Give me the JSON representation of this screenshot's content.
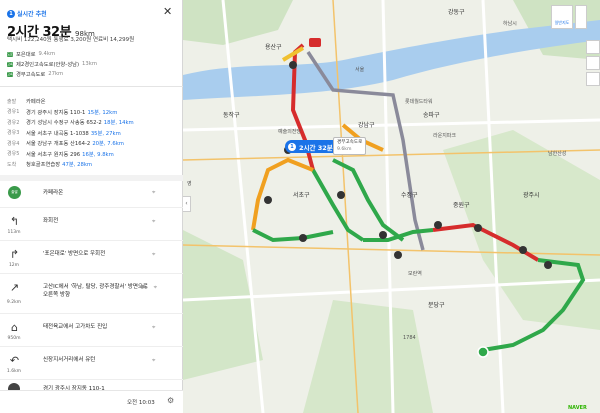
{
  "header": {
    "badge_num": "1",
    "badge_label": "실시간 추천",
    "time": "2시간 32분",
    "distance": "98km",
    "fee": "택시비 122,240원  통행료 3,200원  연료비 14,299원",
    "close": "✕"
  },
  "roads": [
    {
      "tag": "도로",
      "name": "포은대로",
      "dist": "9.4km"
    },
    {
      "tag": "고속",
      "name": "제2경인고속도로(안양-성남)",
      "dist": "13km"
    },
    {
      "tag": "고속",
      "name": "경부고속도로",
      "dist": "27km"
    }
  ],
  "summary": [
    {
      "k": "출발",
      "v": "카페라온",
      "b": ""
    },
    {
      "k": "경유1",
      "v": "경기 광주시 장지동 110-1",
      "b": "15분, 12km"
    },
    {
      "k": "경유2",
      "v": "경기 성남시 수정구 사송동 652-2",
      "b": "18분, 14km"
    },
    {
      "k": "경유3",
      "v": "서울 서초구 내곡동 1-1038",
      "b": "35분, 27km"
    },
    {
      "k": "경유4",
      "v": "서울 강남구 개포동 산164-2",
      "b": "20분, 7.6km"
    },
    {
      "k": "경유5",
      "v": "서울 서초구 원지동 296",
      "b": "16분, 9.8km"
    },
    {
      "k": "도착",
      "v": "청호골프연습장",
      "b": "47분, 28km"
    }
  ],
  "steps": [
    {
      "dist": "",
      "text": "카페라온",
      "kind": "start",
      "start_tag": "출발"
    },
    {
      "dist": "113m",
      "text": "좌회전",
      "icon": "↰"
    },
    {
      "dist": "12m",
      "text": "'포은대로' 방면으로 우회전",
      "icon": "↱"
    },
    {
      "dist": "9.2km",
      "text": "고산IC에서 '하남, 탈당, 광주경찰서' 방면으로 오른쪽 방향",
      "icon": "↗"
    },
    {
      "dist": "950m",
      "text": "태전육교에서 고가차도 진입",
      "icon": "⌂"
    },
    {
      "dist": "1.6km",
      "text": "신장지서거리에서 유턴",
      "icon": "↶"
    },
    {
      "dist": "112m",
      "text": "경기 광주시 장지동 110-1",
      "kind": "end"
    }
  ],
  "footer": {
    "clock": "오전 10:03"
  },
  "map": {
    "badge_num": "1",
    "badge_text": "2시간 32분",
    "box_line1": "경부고속도로",
    "box_line2": "9.6km",
    "top_btn": "일반지도",
    "logo": "NAVER",
    "labels": [
      {
        "t": "용산구"
      },
      {
        "t": "동작구"
      },
      {
        "t": "서초구"
      },
      {
        "t": "강남구"
      },
      {
        "t": "송파구"
      },
      {
        "t": "강동구"
      },
      {
        "t": "하남시"
      },
      {
        "t": "롯데월드타워"
      },
      {
        "t": "수정구"
      },
      {
        "t": "중원구"
      },
      {
        "t": "분당구"
      },
      {
        "t": "광주시"
      },
      {
        "t": "남한산성"
      },
      {
        "t": "예술의전당"
      },
      {
        "t": "라운지파크"
      },
      {
        "t": "서울"
      },
      {
        "t": "영"
      },
      {
        "t": "모란역"
      },
      {
        "t": "1784"
      }
    ]
  }
}
